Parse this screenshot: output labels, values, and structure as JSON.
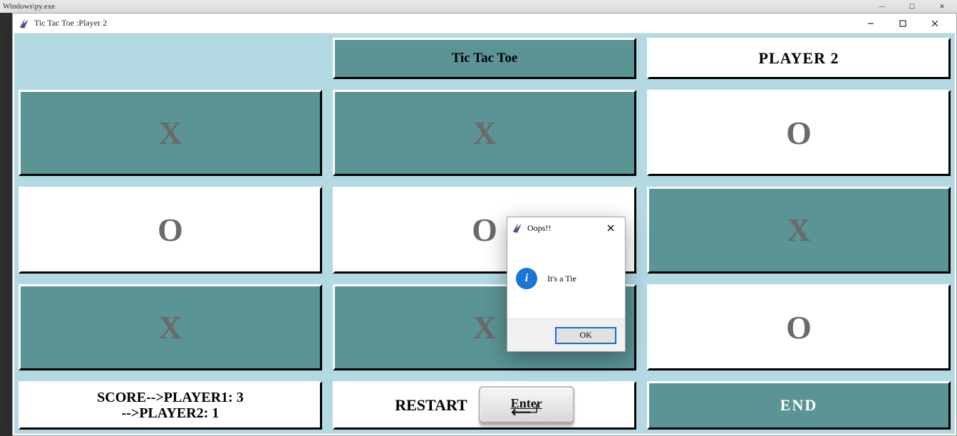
{
  "parent_window": {
    "path": "Windows\\py.exe"
  },
  "window": {
    "title": "Tic Tac Toe :Player 2"
  },
  "header": {
    "title_button": "Tic Tac Toe",
    "player_indicator": "PLAYER 2"
  },
  "board": {
    "cells": [
      "X",
      "X",
      "O",
      "O",
      "O",
      "X",
      "X",
      "X",
      "O"
    ],
    "cell_pressed": [
      true,
      true,
      false,
      false,
      false,
      true,
      true,
      true,
      false
    ]
  },
  "footer": {
    "score_line1": "SCORE-->PLAYER1: 3",
    "score_line2": "-->PLAYER2: 1",
    "restart_label": "RESTART",
    "enter_key_label": "Enter",
    "end_label": "END"
  },
  "dialog": {
    "title": "Oops!!",
    "message": "It's a Tie",
    "ok_label": "OK"
  }
}
